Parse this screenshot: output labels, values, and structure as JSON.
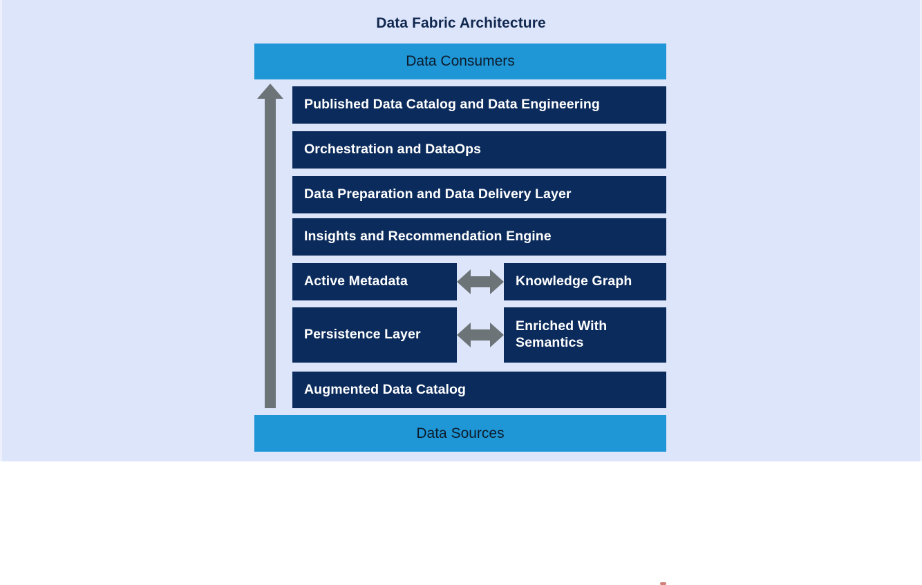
{
  "title": "Data Fabric Architecture",
  "colors": {
    "background": "#dde5fb",
    "banner_blue": "#1f96d6",
    "layer_navy": "#0b2b5c",
    "arrow_gray": "#6d7478",
    "title_text": "#10274e",
    "banner_text": "#0d1b2a",
    "layer_text": "#ffffff"
  },
  "top_banner": {
    "label": "Data Consumers"
  },
  "bottom_banner": {
    "label": "Data Sources"
  },
  "flow_arrow": {
    "name": "upward-flow-arrow",
    "direction": "up",
    "from": "Data Sources",
    "to": "Data Consumers"
  },
  "layers": [
    {
      "id": "published",
      "kind": "full",
      "label": "Published Data Catalog and Data Engineering"
    },
    {
      "id": "orchestr",
      "kind": "full",
      "label": "Orchestration and DataOps"
    },
    {
      "id": "dataprep",
      "kind": "full",
      "label": "Data Preparation and Data Delivery Layer"
    },
    {
      "id": "insights",
      "kind": "full",
      "label": "Insights and Recommendation Engine"
    },
    {
      "id": "metadata",
      "kind": "split",
      "left_label": "Active Metadata",
      "right_label": "Knowledge Graph",
      "connector": "bidirectional-arrow"
    },
    {
      "id": "persist",
      "kind": "split",
      "left_label": "Persistence Layer",
      "right_label": "Enriched With Semantics",
      "connector": "bidirectional-arrow"
    },
    {
      "id": "augmented",
      "kind": "full",
      "label": "Augmented Data Catalog"
    }
  ]
}
